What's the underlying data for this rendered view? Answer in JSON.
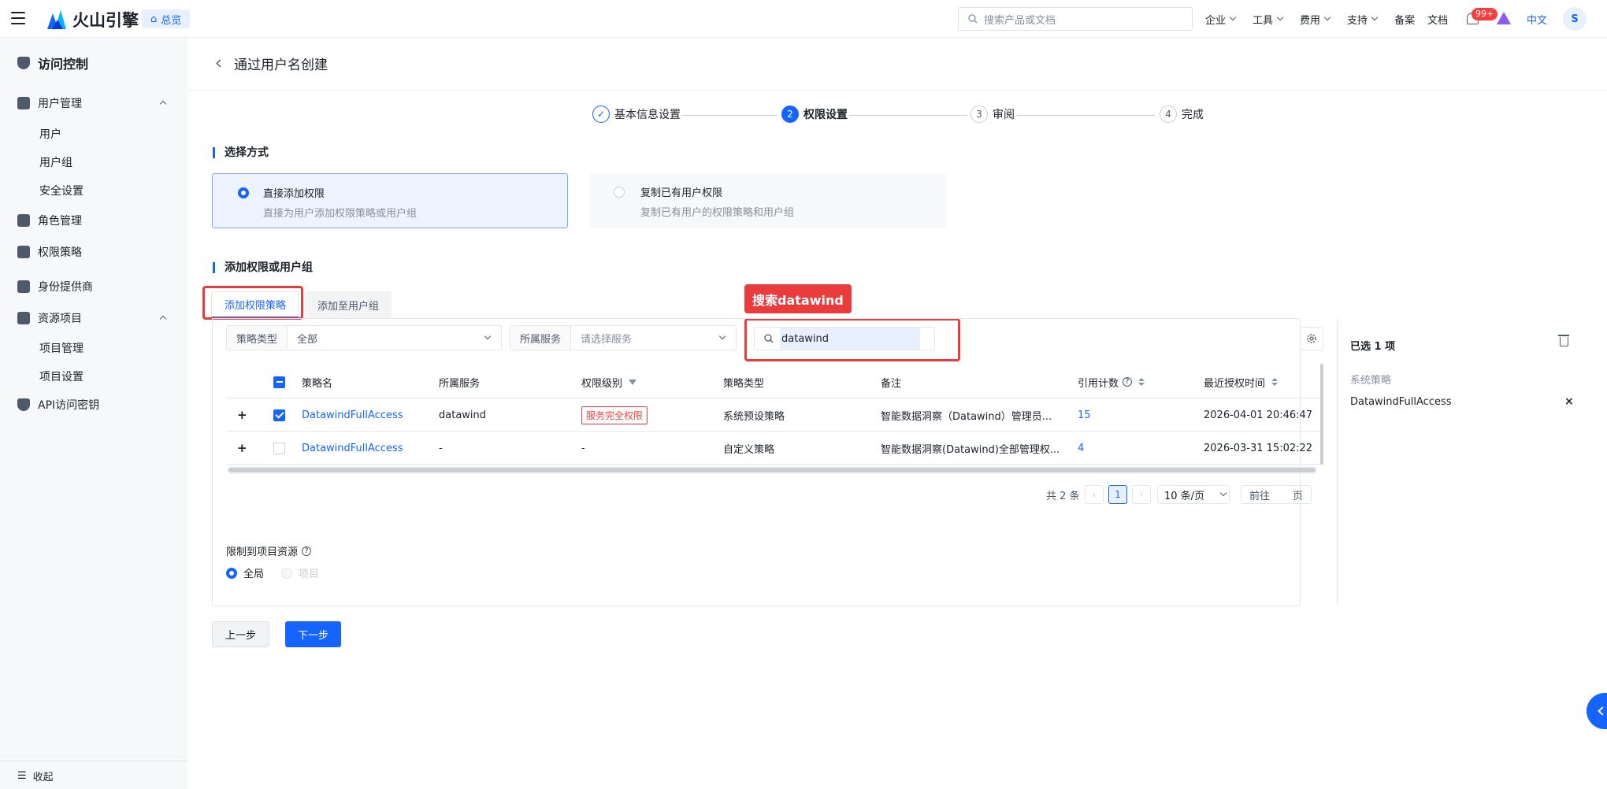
{
  "topbar": {
    "brand": "火山引擎",
    "home_badge": "总览",
    "search_placeholder": "搜索产品或文档",
    "nav": [
      "企业",
      "工具",
      "费用",
      "支持"
    ],
    "links": [
      "备案",
      "文档"
    ],
    "notification_count": "99+",
    "language": "中文",
    "avatar_initial": "S"
  },
  "sidebar": {
    "title": "访问控制",
    "user_mgmt": "用户管理",
    "user_mgmt_items": [
      "用户",
      "用户组",
      "安全设置"
    ],
    "role_mgmt": "角色管理",
    "policy": "权限策略",
    "idp": "身份提供商",
    "project": "资源项目",
    "project_items": [
      "项目管理",
      "项目设置"
    ],
    "api_keys": "API访问密钥",
    "collapse": "收起"
  },
  "page": {
    "title": "通过用户名创建",
    "steps": [
      {
        "num": "✓",
        "label": "基本信息设置"
      },
      {
        "num": "2",
        "label": "权限设置"
      },
      {
        "num": "3",
        "label": "审阅"
      },
      {
        "num": "4",
        "label": "完成"
      }
    ],
    "choose_method": "选择方式",
    "option_direct_title": "直接添加权限",
    "option_direct_desc": "直接为用户添加权限策略或用户组",
    "option_copy_title": "复制已有用户权限",
    "option_copy_desc": "复制已有用户的权限策略和用户组",
    "add_section": "添加权限或用户组",
    "tab_policy": "添加权限策略",
    "tab_group": "添加至用户组",
    "annotation": "搜索datawind"
  },
  "filters": {
    "type_label": "策略类型",
    "type_value": "全部",
    "service_label": "所属服务",
    "service_placeholder": "请选择服务",
    "search_value": "datawind"
  },
  "table": {
    "headers": {
      "name": "策略名",
      "service": "所属服务",
      "level": "权限级别",
      "type": "策略类型",
      "note": "备注",
      "refs": "引用计数",
      "last": "最近授权时间"
    },
    "rows": [
      {
        "name": "DatawindFullAccess",
        "service": "datawind",
        "level": "服务完全权限",
        "type": "系统预设策略",
        "note": "智能数据洞察（Datawind）管理员...",
        "refs": "15",
        "last": "2026-04-01 20:46:47"
      },
      {
        "name": "DatawindFullAccess",
        "service": "-",
        "level": "-",
        "type": "自定义策略",
        "note": "智能数据洞察(Datawind)全部管理权...",
        "refs": "4",
        "last": "2026-03-31 15:02:22"
      }
    ]
  },
  "pagination": {
    "total": "共 2 条",
    "current": "1",
    "page_size": "10 条/页",
    "goto": "前往",
    "page_unit": "页"
  },
  "restrict": {
    "label": "限制到项目资源",
    "global": "全局",
    "project": "项目"
  },
  "selected": {
    "title": "已选 1 项",
    "category": "系统策略",
    "item": "DatawindFullAccess"
  },
  "buttons": {
    "prev": "上一步",
    "next": "下一步"
  },
  "colors": {
    "primary": "#1664ff",
    "annotation_red": "#ea3c3c",
    "danger": "#f53f3f"
  }
}
